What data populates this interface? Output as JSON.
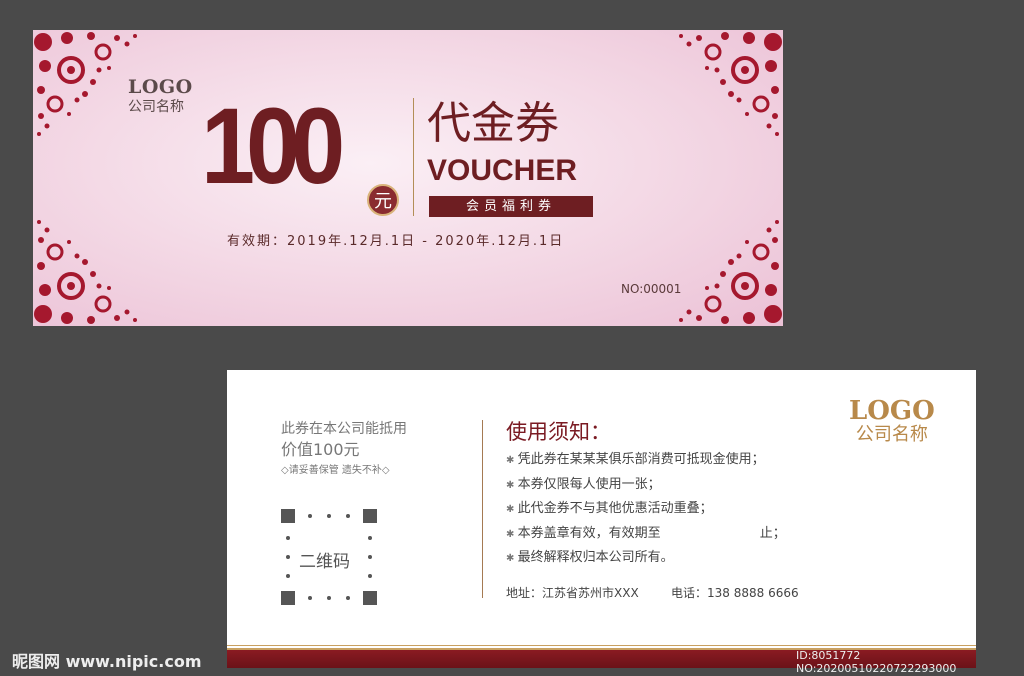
{
  "front": {
    "logo": "LOGO",
    "company_name": "公司名称",
    "amount": "100",
    "currency_unit": "元",
    "title_cn": "代金券",
    "title_en": "VOUCHER",
    "member_label": "会员福利券",
    "validity": "有效期：2019年.12月.1日 - 2020年.12月.1日",
    "serial": "NO:00001",
    "colors": {
      "accent": "#6e1e22",
      "background": "#f2d4e2",
      "lace": "#a5182e",
      "gold": "#c9a060"
    }
  },
  "back": {
    "value_line1": "此券在本公司能抵用",
    "value_line2": "价值100元",
    "keep_note": "◇请妥善保管 遗失不补◇",
    "qr_label": "二维码",
    "notice_title": "使用须知：",
    "rules": [
      "凭此券在某某某俱乐部消费可抵现金使用；",
      "本券仅限每人使用一张；",
      "此代金券不与其他优惠活动重叠；",
      "本券盖章有效，有效期至                        止；",
      "最终解释权归本公司所有。"
    ],
    "address": "地址：江苏省苏州市XXX",
    "phone": "电话：138 8888 6666",
    "logo": "LOGO",
    "company_name": "公司名称"
  },
  "watermark": {
    "site": "昵图网 www.nipic.com",
    "id_text": "ID:8051772 NO:20200510220722293000"
  }
}
